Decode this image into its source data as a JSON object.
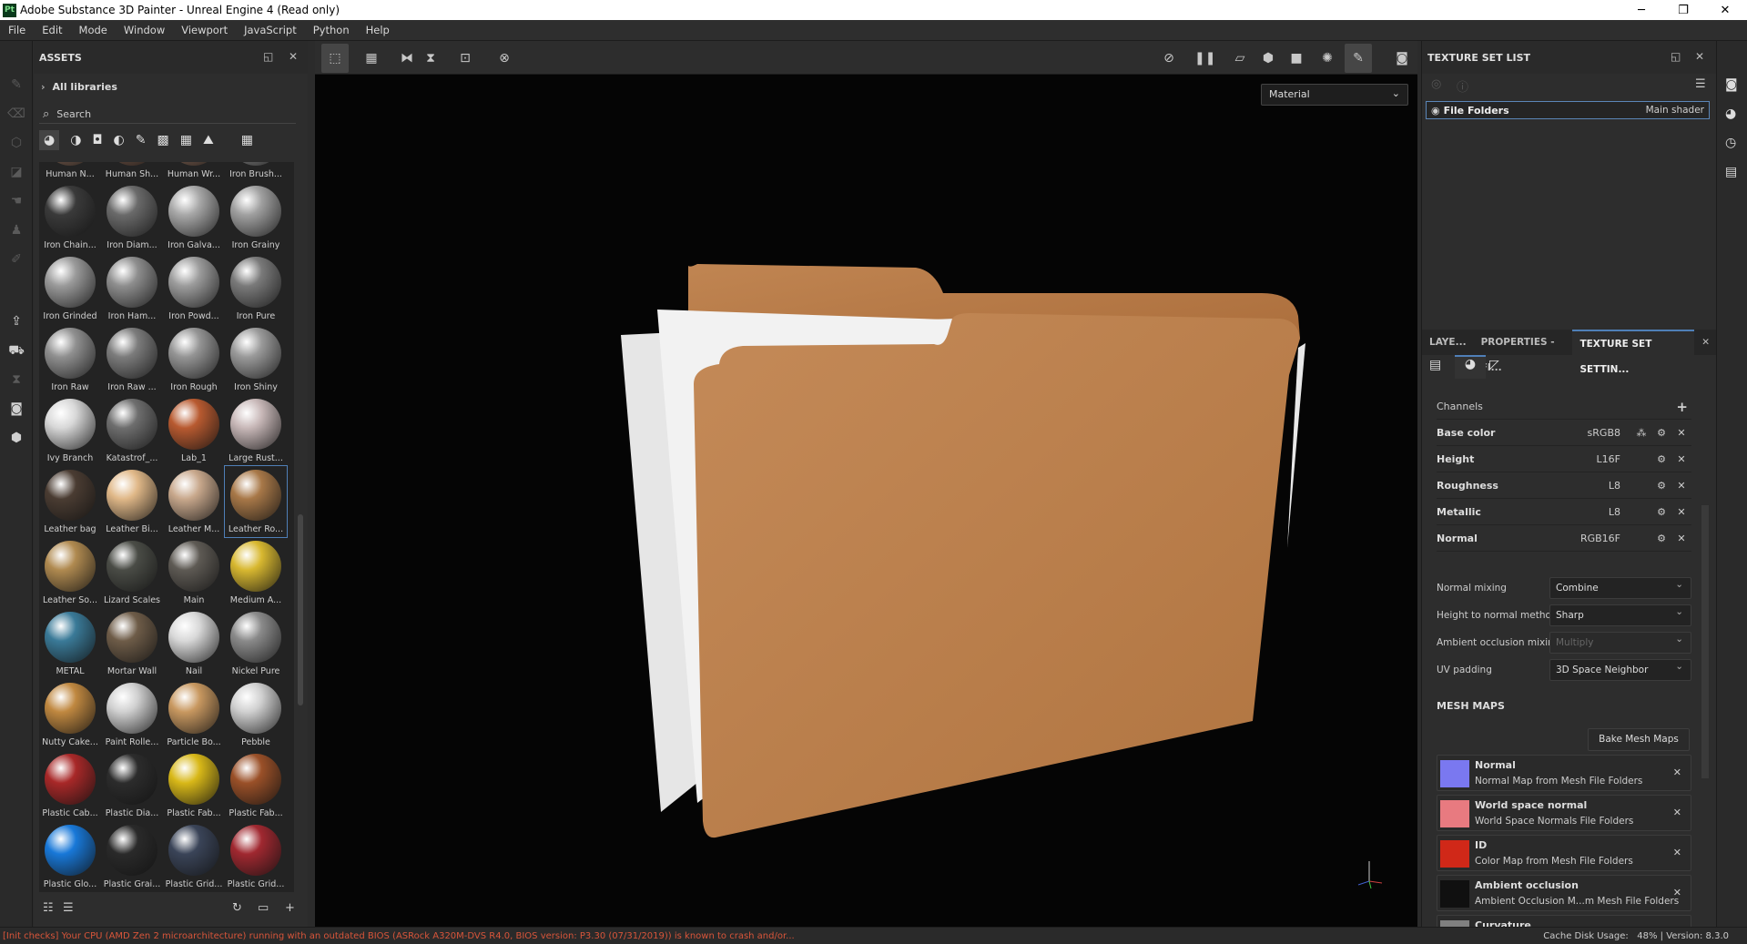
{
  "window": {
    "title": "Adobe Substance 3D Painter - Unreal Engine 4 (Read only)",
    "logo": "Pt",
    "min": "─",
    "max": "❐",
    "close": "✕"
  },
  "menu": [
    "File",
    "Edit",
    "Mode",
    "Window",
    "Viewport",
    "JavaScript",
    "Python",
    "Help"
  ],
  "assets": {
    "title": "ASSETS",
    "breadcrumb": "All libraries",
    "search_placeholder": "Search",
    "items": [
      {
        "name": "Human N...",
        "color": "#8a6a58"
      },
      {
        "name": "Human Sh...",
        "color": "#7a5a4a"
      },
      {
        "name": "Human Wr...",
        "color": "#8a6a58"
      },
      {
        "name": "Iron Brush...",
        "color": "#909090"
      },
      {
        "name": "Iron Chain...",
        "color": "#3a3a3a"
      },
      {
        "name": "Iron Diam...",
        "color": "#6a6a6a"
      },
      {
        "name": "Iron Galva...",
        "color": "#a8a8a8"
      },
      {
        "name": "Iron Grainy",
        "color": "#a0a0a0"
      },
      {
        "name": "Iron Grinded",
        "color": "#9a9a9a"
      },
      {
        "name": "Iron Ham...",
        "color": "#8e8e8e"
      },
      {
        "name": "Iron Powd...",
        "color": "#9c9c9c"
      },
      {
        "name": "Iron Pure",
        "color": "#7a7a7a"
      },
      {
        "name": "Iron Raw",
        "color": "#909090"
      },
      {
        "name": "Iron Raw ...",
        "color": "#7c7c7c"
      },
      {
        "name": "Iron Rough",
        "color": "#959595"
      },
      {
        "name": "Iron Shiny",
        "color": "#9a9a9a"
      },
      {
        "name": "Ivy Branch",
        "color": "#d8d8d8"
      },
      {
        "name": "Katastrof_...",
        "color": "#6e6e6e"
      },
      {
        "name": "Lab_1",
        "color": "#b85a30"
      },
      {
        "name": "Large Rust...",
        "color": "#c8b8b8"
      },
      {
        "name": "Leather bag",
        "color": "#4a3c32"
      },
      {
        "name": "Leather Bi...",
        "color": "#e0b888"
      },
      {
        "name": "Leather M...",
        "color": "#c8a88c"
      },
      {
        "name": "Leather Ro...",
        "color": "#a87848"
      },
      {
        "name": "Leather So...",
        "color": "#b08a50"
      },
      {
        "name": "Lizard Scales",
        "color": "#4a4c46"
      },
      {
        "name": "Main",
        "color": "#5e5a54"
      },
      {
        "name": "Medium A...",
        "color": "#d8b830"
      },
      {
        "name": "METAL",
        "color": "#3a7a98"
      },
      {
        "name": "Mortar Wall",
        "color": "#6e5c48"
      },
      {
        "name": "Nail",
        "color": "#d8d8d8"
      },
      {
        "name": "Nickel Pure",
        "color": "#8a8a8a"
      },
      {
        "name": "Nutty Cake...",
        "color": "#c08840"
      },
      {
        "name": "Paint Rolle...",
        "color": "#d0d0d0"
      },
      {
        "name": "Particle Bo...",
        "color": "#c89860"
      },
      {
        "name": "Pebble",
        "color": "#d0d0d0"
      },
      {
        "name": "Plastic Cab...",
        "color": "#a82828"
      },
      {
        "name": "Plastic Dia...",
        "color": "#2c2c2c"
      },
      {
        "name": "Plastic Fab...",
        "color": "#d8b818"
      },
      {
        "name": "Plastic Fab...",
        "color": "#9a5028"
      },
      {
        "name": "Plastic Glo...",
        "color": "#1878d8"
      },
      {
        "name": "Plastic Grai...",
        "color": "#2a2a2a"
      },
      {
        "name": "Plastic Grid...",
        "color": "#3a4458"
      },
      {
        "name": "Plastic Grid...",
        "color": "#a02830"
      }
    ]
  },
  "viewport": {
    "mode": "Material"
  },
  "texture_set_list": {
    "title": "TEXTURE SET LIST",
    "set_name": "File Folders",
    "shader": "Main shader"
  },
  "tabs": [
    {
      "label": "LAYE..."
    },
    {
      "label": "PROPERTIES - FI..."
    },
    {
      "label": "TEXTURE SET SETTIN..."
    }
  ],
  "channels": {
    "title": "Channels",
    "rows": [
      {
        "name": "Base color",
        "format": "sRGB8"
      },
      {
        "name": "Height",
        "format": "L16F"
      },
      {
        "name": "Roughness",
        "format": "L8"
      },
      {
        "name": "Metallic",
        "format": "L8"
      },
      {
        "name": "Normal",
        "format": "RGB16F"
      }
    ]
  },
  "props": [
    {
      "label": "Normal mixing",
      "value": "Combine"
    },
    {
      "label": "Height to normal method",
      "value": "Sharp"
    },
    {
      "label": "Ambient occlusion mixing",
      "value": "Multiply"
    },
    {
      "label": "UV padding",
      "value": "3D Space Neighbor"
    }
  ],
  "mesh_maps": {
    "title": "MESH MAPS",
    "bake": "Bake Mesh Maps",
    "items": [
      {
        "name": "Normal",
        "desc": "Normal Map from Mesh File Folders",
        "color": "#7a78f0"
      },
      {
        "name": "World space normal",
        "desc": "World Space Normals File Folders",
        "color": "#e87a80"
      },
      {
        "name": "ID",
        "desc": "Color Map from Mesh File Folders",
        "color": "#d02818"
      },
      {
        "name": "Ambient occlusion",
        "desc": "Ambient Occlusion M...m Mesh File Folders",
        "color": "#101010"
      },
      {
        "name": "Curvature",
        "desc": "",
        "color": "#808080"
      }
    ]
  },
  "status": {
    "message": "[Init checks] Your CPU (AMD Zen 2 microarchitecture) running with an outdated BIOS (ASRock A320M-DVS R4.0, BIOS version: P3.30 (07/31/2019)) is known to crash and/or...",
    "cache": "Cache Disk Usage:   48% | Version: 8.3.0"
  }
}
